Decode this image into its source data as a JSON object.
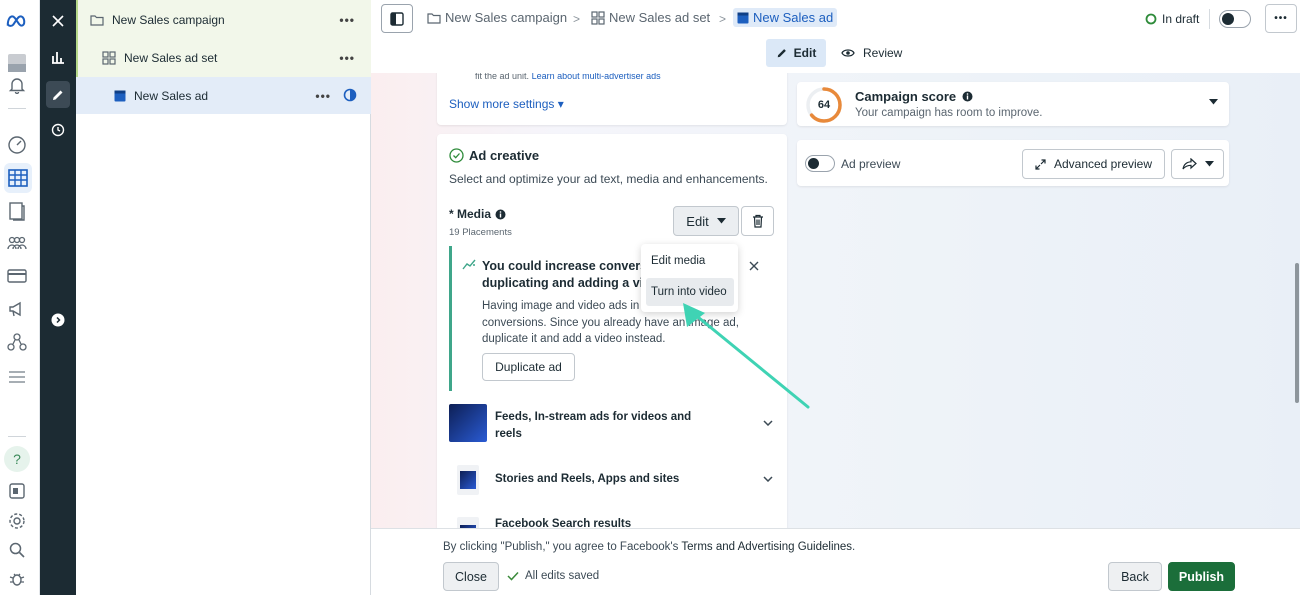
{
  "tree": {
    "campaign": "New Sales campaign",
    "adset": "New Sales ad set",
    "ad": "New Sales ad",
    "more": "•••"
  },
  "breadcrumb": {
    "campaign": "New Sales campaign",
    "adset": "New Sales ad set",
    "ad": "New Sales ad",
    "separator": ">"
  },
  "status": {
    "label": "In draft"
  },
  "more_menu": "•••",
  "tabs": {
    "edit": "Edit",
    "review": "Review"
  },
  "settings": {
    "truncated_text": "fit the ad unit.",
    "learn_link": "Learn about multi-advertiser ads",
    "show_more": "Show more settings ▾"
  },
  "campaign_score": {
    "score": "64",
    "score_value": 64,
    "title": "Campaign score",
    "subtitle": "Your campaign has room to improve.",
    "ring_color": "#e8893a"
  },
  "preview": {
    "label": "Ad preview",
    "advanced": "Advanced preview"
  },
  "ad_creative": {
    "title": "Ad creative",
    "description": "Select and optimize your ad text, media and enhancements.",
    "media_label": "* Media",
    "placements": "19 Placements",
    "edit_button": "Edit"
  },
  "suggestion": {
    "title_line1": "You could increase conversi",
    "title_line2": "duplicating and adding a vi",
    "body_line1": "Having image and video ads in",
    "body_line1_tail": "th",
    "body_line2": "conversions. Since you already have an image ad,",
    "body_line3": "duplicate it and add a video instead.",
    "button": "Duplicate ad"
  },
  "dropdown": {
    "items": [
      "Edit media",
      "Turn into video"
    ]
  },
  "placements": [
    {
      "line1": "Feeds, In-stream ads for videos and",
      "line2": "reels"
    },
    {
      "line1": "Stories and Reels, Apps and sites",
      "line2": ""
    },
    {
      "line1": "Facebook Search results",
      "line2": ""
    }
  ],
  "footer": {
    "terms_prefix": "By clicking \"Publish,\" you agree to Facebook's",
    "terms_link": "Terms and Advertising Guidelines",
    "terms_suffix": ".",
    "close": "Close",
    "saved": "All edits saved",
    "back": "Back",
    "publish": "Publish"
  },
  "colors": {
    "accent": "#1d5fbf",
    "publish": "#1b6e3a",
    "teal_arrow": "#3fd3b4",
    "saved_green": "#3a8a3a"
  }
}
